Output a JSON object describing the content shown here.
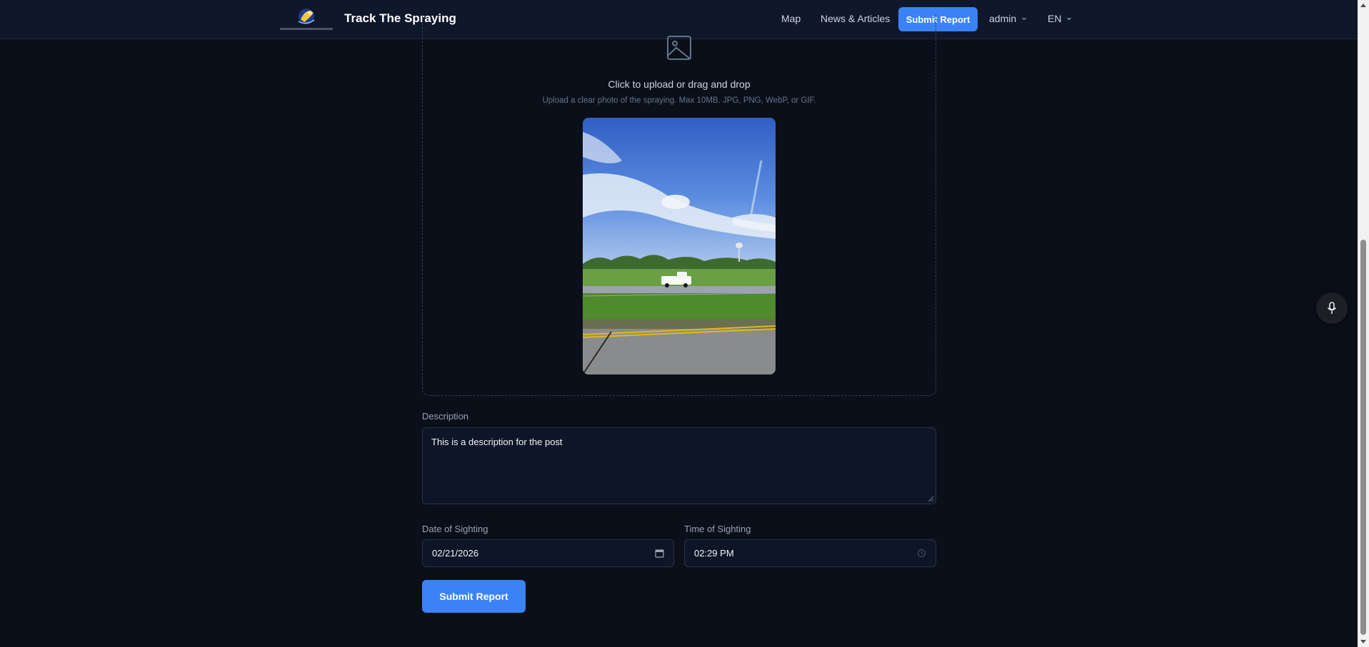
{
  "header": {
    "brand": "Track The Spraying",
    "nav": {
      "map": "Map",
      "news": "News & Articles",
      "submit": "Submit Report",
      "user": "admin",
      "language": "EN"
    }
  },
  "upload": {
    "title": "Click to upload or drag and drop",
    "hint": "Upload a clear photo of the spraying. Max 10MB. JPG, PNG, WebP, or GIF."
  },
  "form": {
    "description_label": "Description",
    "description_value": "This is a description for the post",
    "date_label": "Date of Sighting",
    "date_value": "02/21/2026",
    "time_label": "Time of Sighting",
    "time_value": "02:29 PM",
    "submit_label": "Submit Report"
  },
  "colors": {
    "accent": "#3b82f6",
    "background": "#0b0f19",
    "header": "#0f172a"
  },
  "icons": {
    "upload": "image-icon",
    "date": "calendar-icon",
    "time": "clock-icon",
    "voice": "microphone-icon"
  }
}
